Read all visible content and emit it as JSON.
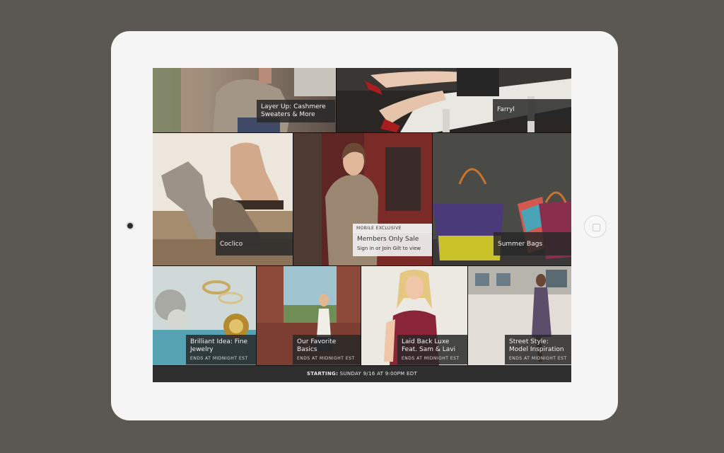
{
  "tiles": [
    {
      "id": "cashmere",
      "title": "Layer Up: Cashmere Sweaters & More"
    },
    {
      "id": "farryl",
      "title": "Farryl"
    },
    {
      "id": "coclico",
      "title": "Coclico"
    },
    {
      "id": "members",
      "tag": "MOBILE EXCLUSIVE",
      "title": "Members Only Sale",
      "sub": "Sign in or Join Gilt to view"
    },
    {
      "id": "summer-bags",
      "title": "Summer Bags"
    },
    {
      "id": "jewelry",
      "title": "Brilliant Idea: Fine Jewelry",
      "sub": "ENDS AT MIDNIGHT EST"
    },
    {
      "id": "basics",
      "title": "Our Favorite Basics",
      "sub": "ENDS AT MIDNIGHT EST"
    },
    {
      "id": "laid-back",
      "title": "Laid Back Luxe Feat. Sam & Lavi",
      "sub": "ENDS AT MIDNIGHT EST"
    },
    {
      "id": "street-style",
      "title": "Street Style: Model Inspiration",
      "sub": "ENDS AT MIDNIGHT EST"
    }
  ],
  "bottombar": {
    "label": "STARTING:",
    "value": "SUNDAY 9/16 AT 9:00PM EDT"
  }
}
